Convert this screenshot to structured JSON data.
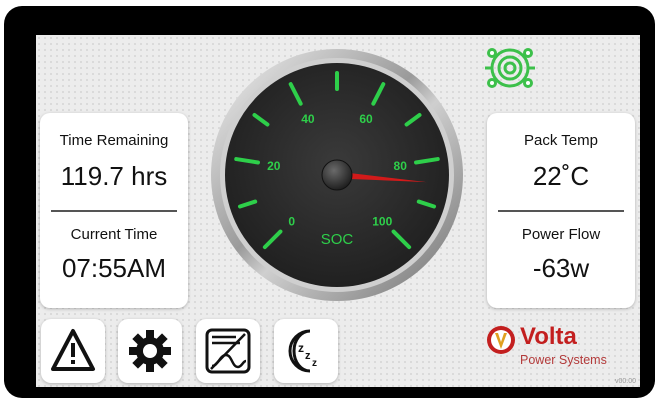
{
  "left_panel": {
    "time_remaining_label": "Time Remaining",
    "time_remaining_value": "119.7 hrs",
    "current_time_label": "Current Time",
    "current_time_value": "07:55AM"
  },
  "right_panel": {
    "pack_temp_label": "Pack Temp",
    "pack_temp_value": "22˚C",
    "power_flow_label": "Power Flow",
    "power_flow_value": "-63w"
  },
  "gauge": {
    "label": "SOC",
    "ticks": [
      "0",
      "20",
      "40",
      "60",
      "80",
      "100"
    ],
    "value": 85,
    "tick_color": "#2ecf4a",
    "needle_color": "#d21a1a"
  },
  "toolbar": {
    "buttons": [
      {
        "icon": "warning-icon"
      },
      {
        "icon": "gear-icon"
      },
      {
        "icon": "power-graph-icon"
      },
      {
        "icon": "sleep-icon"
      }
    ]
  },
  "status": {
    "motor_icon": "motor-icon",
    "motor_color": "#3cc04a"
  },
  "brand": {
    "name": "Volta",
    "tagline": "Power Systems",
    "version": "v00.00",
    "color": "#c31f1f"
  }
}
